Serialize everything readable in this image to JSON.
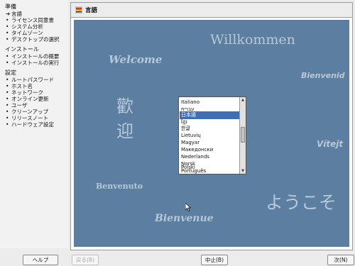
{
  "sidebar": {
    "prep_title": "準備",
    "prep_items": [
      {
        "label": "言語",
        "current": true
      },
      {
        "label": "ライセンス同意書"
      },
      {
        "label": "システム分析"
      },
      {
        "label": "タイムゾーン"
      },
      {
        "label": "デスクトップの選択"
      }
    ],
    "install_title": "インストール",
    "install_items": [
      {
        "label": "インストールの概要"
      },
      {
        "label": "インストールの実行"
      }
    ],
    "config_title": "設定",
    "config_items": [
      {
        "label": "ルートパスワード"
      },
      {
        "label": "ホスト名"
      },
      {
        "label": "ネットワーク"
      },
      {
        "label": "オンライン更新"
      },
      {
        "label": "ユーザ"
      },
      {
        "label": "クリーンアップ"
      },
      {
        "label": "リリースノート"
      },
      {
        "label": "ハードウェア設定"
      }
    ]
  },
  "panel": {
    "title": "言語"
  },
  "greetings": [
    "Willkommen",
    "Welcome",
    "Bienvenid",
    "歡",
    "迎",
    "Vítejt",
    "Benvenuto",
    "ようこそ",
    "Bienvenue"
  ],
  "language_list": {
    "items": [
      "Italiano",
      "עברית",
      "日本語",
      "ខ្មែរ",
      "한글",
      "Lietuvių",
      "Magyar",
      "Македонски",
      "Nederlands",
      "Norsk",
      "Polski",
      "Português"
    ],
    "selected": "日本語"
  },
  "buttons": {
    "help": "ヘルプ",
    "back": "戻る(B)",
    "abort": "中止(B)",
    "next": "次(N)"
  },
  "icons": {
    "current_step": "arrow-right-icon",
    "bullet": "bullet-icon",
    "panel": "flag-icon"
  }
}
